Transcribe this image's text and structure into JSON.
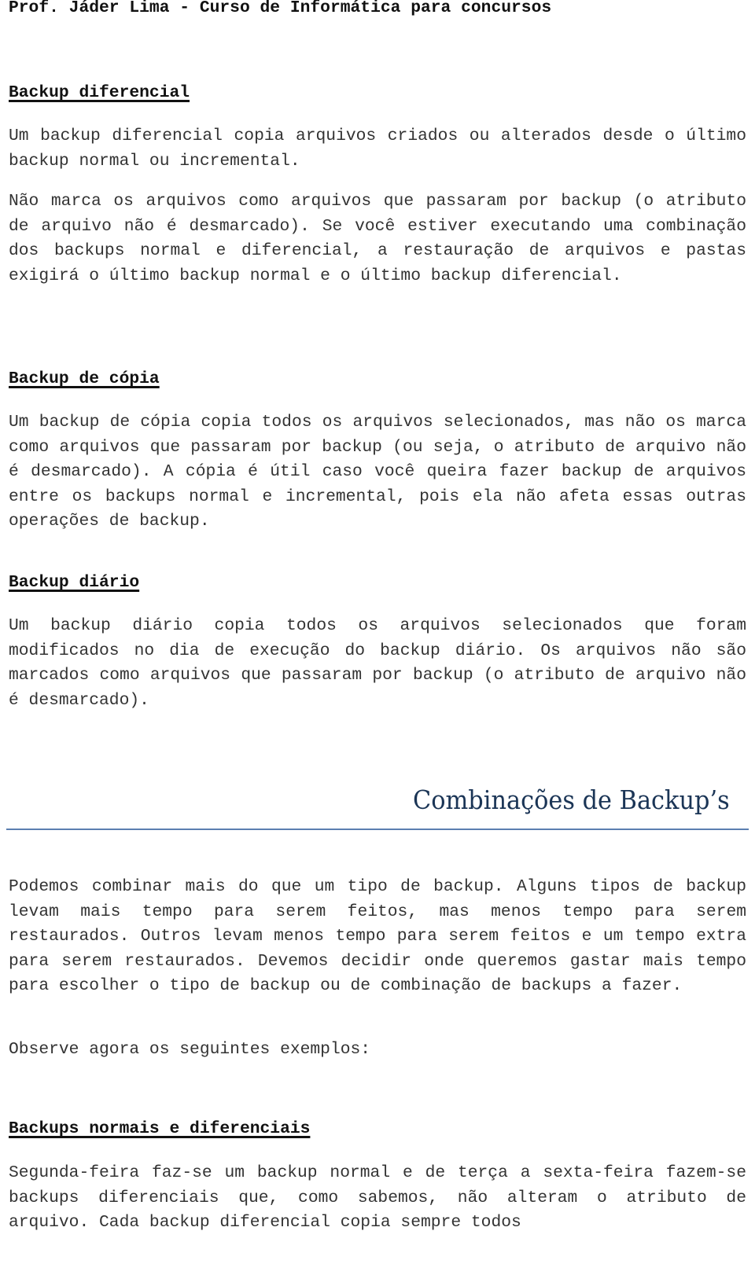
{
  "header": "Prof. Jáder Lima - Curso de Informática para concursos",
  "sections": [
    {
      "heading": "Backup diferencial",
      "paragraphs": [
        "Um backup diferencial copia arquivos criados ou alterados desde o último backup normal ou incremental.",
        "Não marca os arquivos como arquivos que passaram por backup (o atributo de arquivo não é desmarcado). Se você estiver executando uma combinação dos backups normal e diferencial, a restauração de arquivos e pastas exigirá o último backup normal e o último backup diferencial."
      ]
    },
    {
      "heading": "Backup de cópia",
      "paragraphs": [
        "Um backup de cópia copia todos os arquivos selecionados, mas não os marca como arquivos que passaram por backup (ou seja, o atributo de arquivo não é desmarcado). A cópia é útil caso você queira fazer backup de arquivos entre os backups normal e incremental, pois ela não afeta essas outras operações de backup."
      ]
    },
    {
      "heading": "Backup diário",
      "paragraphs": [
        "Um backup diário copia todos os arquivos selecionados que foram modificados no dia de execução do backup diário. Os arquivos não são marcados como arquivos que passaram por backup (o atributo de arquivo não é desmarcado)."
      ]
    }
  ],
  "chapter": {
    "title": "Combinações de Backup’s",
    "paragraphs": [
      "Podemos combinar mais do que um tipo de backup. Alguns tipos de backup levam mais tempo para serem feitos, mas menos tempo para serem restaurados. Outros levam menos tempo para serem feitos e um tempo extra para serem restaurados. Devemos decidir onde queremos gastar mais tempo para escolher o tipo de backup ou de combinação de backups a fazer.",
      "Observe agora os seguintes exemplos:"
    ],
    "subsection": {
      "heading": "Backups normais e diferenciais",
      "paragraph": "Segunda-feira faz-se um backup normal e de terça a sexta-feira fazem-se backups diferenciais que, como sabemos, não alteram o atributo de arquivo. Cada backup diferencial copia sempre todos"
    }
  }
}
